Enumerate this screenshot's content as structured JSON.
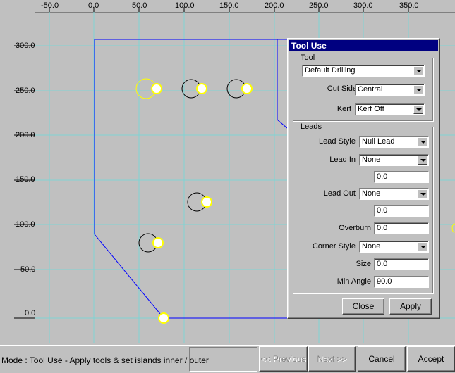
{
  "ruler_top": [
    "-50.0",
    "0.0",
    "50.0",
    "100.0",
    "150.0",
    "200.0",
    "250.0",
    "300.0",
    "350.0"
  ],
  "ruler_left": [
    "300.0",
    "250.0",
    "200.0",
    "150.0",
    "100.0",
    "50.0",
    "0.0"
  ],
  "dialog": {
    "title": "Tool Use",
    "tool_group": "Tool",
    "tool_value": "Default Drilling",
    "cut_side_label": "Cut Side",
    "cut_side_value": "Central",
    "kerf_label": "Kerf",
    "kerf_value": "Kerf Off",
    "leads_group": "Leads",
    "lead_style_label": "Lead Style",
    "lead_style_value": "Null Lead",
    "lead_in_label": "Lead In",
    "lead_in_value": "None",
    "lead_in_amount": "0.0",
    "lead_out_label": "Lead Out",
    "lead_out_value": "None",
    "lead_out_amount": "0.0",
    "overburn_label": "Overburn",
    "overburn_value": "0.0",
    "corner_style_label": "Corner Style",
    "corner_style_value": "None",
    "size_label": "Size",
    "size_value": "0.0",
    "min_angle_label": "Min Angle",
    "min_angle_value": "90.0",
    "close_label": "Close",
    "apply_label": "Apply"
  },
  "statusbar": {
    "mode_text": "Mode : Tool Use - Apply tools & set islands inner / outer",
    "previous_label": "<< Previous",
    "next_label": "Next >>",
    "cancel_label": "Cancel",
    "accept_label": "Accept"
  },
  "colors": {
    "background": "#c0c0c0",
    "grid": "#7fd4d4",
    "profile": "#0000ff",
    "selected_hole": "#ffff00",
    "title_bar": "#000080"
  }
}
